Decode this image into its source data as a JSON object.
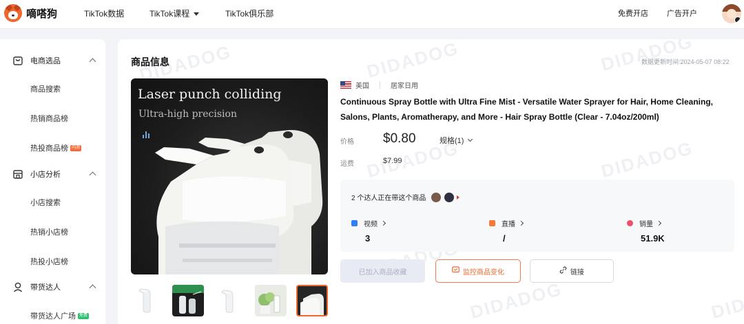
{
  "topnav": {
    "brand": "嘀嗒狗",
    "links": [
      "TikTok数据",
      "TikTok课程",
      "TikTok俱乐部"
    ],
    "open_store": "免费开店",
    "ad_account": "广告开户"
  },
  "sidebar": {
    "groups": [
      {
        "label": "电商选品",
        "items": [
          {
            "label": "商品搜索"
          },
          {
            "label": "热销商品榜"
          },
          {
            "label": "热投商品榜",
            "tag": "内测"
          }
        ]
      },
      {
        "label": "小店分析",
        "items": [
          {
            "label": "小店搜索"
          },
          {
            "label": "热销小店榜"
          },
          {
            "label": "热投小店榜"
          }
        ]
      },
      {
        "label": "带货达人",
        "items": [
          {
            "label": "带货达人广场",
            "tag": "免费"
          }
        ]
      }
    ]
  },
  "watermark": "DIDADOG",
  "product": {
    "section_title": "商品信息",
    "update_label": "数据更新时间",
    "update_time": "2024-05-07 08:22",
    "image_title": "Laser punch colliding",
    "image_subtitle": "Ultra-high precision",
    "region": "美国",
    "category": "居家日用",
    "title": "Continuous Spray Bottle with Ultra Fine Mist - Versatile Water Sprayer for Hair, Home Cleaning, Salons, Plants, Aromatherapy, and More - Hair Spray Bottle (Clear - 7.04oz/200ml)",
    "price_label": "价格",
    "price": "$0.80",
    "spec_label": "规格(1)",
    "shipping_label": "运费",
    "shipping": "$7.99",
    "creators_text": "2 个达人正在带这个商品",
    "stats": [
      {
        "label": "视频",
        "value": "3",
        "color": "#2f7ff5"
      },
      {
        "label": "直播",
        "value": "/",
        "color": "#f47b3a"
      },
      {
        "label": "销量",
        "value": "51.9K",
        "color": "#ef4f6b"
      }
    ],
    "buttons": {
      "favorite": "已加入商品收藏",
      "monitor": "监控商品变化",
      "link": "链接"
    }
  },
  "colors": {
    "accent": "#f0672d",
    "page_bg": "#f3f4f7",
    "disabled_text": "#aab1c4"
  }
}
